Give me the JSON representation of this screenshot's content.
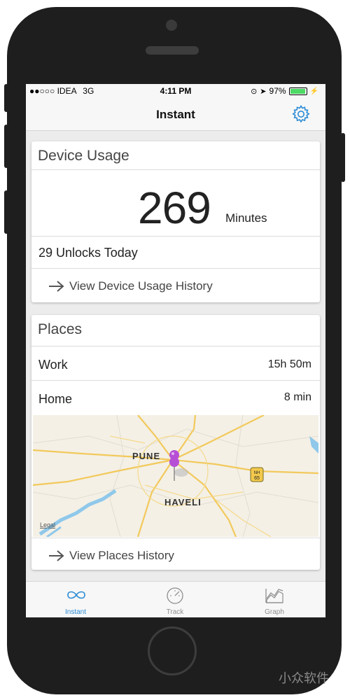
{
  "status_bar": {
    "carrier": "●●○○○ IDEA",
    "network": "3G",
    "time": "4:11 PM",
    "battery": "97%"
  },
  "nav": {
    "title": "Instant"
  },
  "device_usage": {
    "title": "Device Usage",
    "minutes": "269",
    "minutes_unit": "Minutes",
    "unlocks": "29 Unlocks Today",
    "history_link": "View Device Usage History"
  },
  "places": {
    "title": "Places",
    "items": [
      {
        "name": "Work",
        "duration": "15h 50m"
      },
      {
        "name": "Home",
        "duration": "8 min"
      }
    ],
    "map": {
      "city_label": "PUNE",
      "district_label": "HAVELI",
      "highway_label": "NH\n65",
      "legal": "Legal"
    },
    "history_link": "View Places History"
  },
  "tabs": [
    {
      "label": "Instant",
      "active": true
    },
    {
      "label": "Track",
      "active": false
    },
    {
      "label": "Graph",
      "active": false
    }
  ],
  "watermark": "小众软件",
  "colors": {
    "accent": "#2a8ad4",
    "pin": "#b64fd6",
    "map_road": "#f2c95c",
    "water": "#8fc8ea"
  }
}
